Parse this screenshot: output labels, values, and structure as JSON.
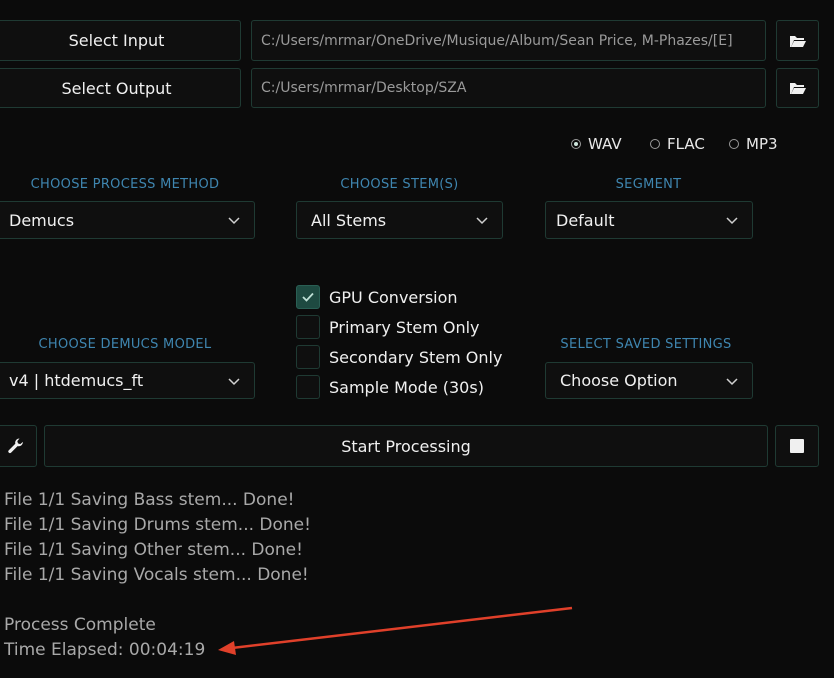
{
  "io": {
    "select_input_label": "Select Input",
    "select_output_label": "Select Output",
    "input_path": "C:/Users/mrmar/OneDrive/Musique/Album/Sean Price, M-Phazes/[E]",
    "output_path": "C:/Users/mrmar/Desktop/SZA"
  },
  "format": {
    "options": [
      "WAV",
      "FLAC",
      "MP3"
    ],
    "selected": "WAV"
  },
  "process_method": {
    "label": "CHOOSE PROCESS METHOD",
    "value": "Demucs"
  },
  "stems": {
    "label": "CHOOSE STEM(S)",
    "value": "All Stems"
  },
  "segment": {
    "label": "SEGMENT",
    "value": "Default"
  },
  "demucs_model": {
    "label": "CHOOSE DEMUCS MODEL",
    "value": "v4 | htdemucs_ft"
  },
  "saved_settings": {
    "label": "SELECT SAVED SETTINGS",
    "value": "Choose Option"
  },
  "options": [
    {
      "label": "GPU Conversion",
      "checked": true
    },
    {
      "label": "Primary Stem Only",
      "checked": false
    },
    {
      "label": "Secondary Stem Only",
      "checked": false
    },
    {
      "label": "Sample Mode (30s)",
      "checked": false
    }
  ],
  "actions": {
    "start_label": "Start Processing"
  },
  "console": {
    "lines": [
      "File 1/1 Saving Bass stem... Done!",
      "File 1/1 Saving Drums stem... Done!",
      "File 1/1 Saving Other stem... Done!",
      "File 1/1 Saving Vocals stem... Done!"
    ],
    "status": "Process Complete",
    "elapsed": "Time Elapsed: 00:04:19"
  },
  "colors": {
    "background": "#0b0b0b",
    "border": "#1f3a33",
    "accent_label": "#3f86b0",
    "checked_box": "#1e4a41",
    "annotation_arrow": "#e0402a"
  },
  "icons": [
    "folder-icon",
    "wrench-icon",
    "stop-icon",
    "chevron-down-icon",
    "check-icon"
  ]
}
